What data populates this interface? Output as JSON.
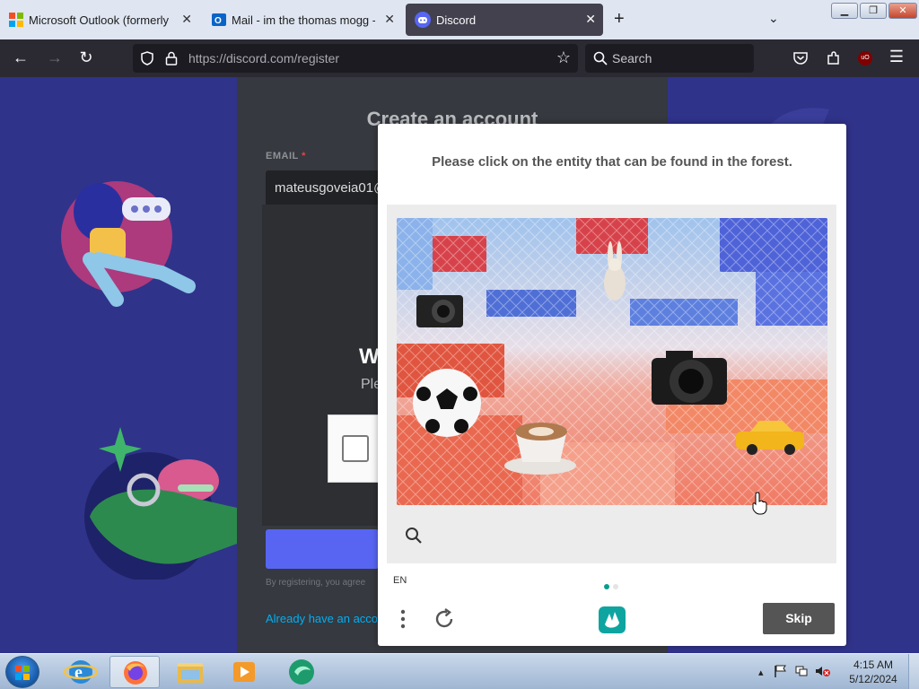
{
  "browser": {
    "tabs": [
      {
        "title": "Microsoft Outlook (formerly Ha",
        "icon": "microsoft-logo-icon",
        "active": false
      },
      {
        "title": "Mail - im the thomas mogg - O",
        "icon": "outlook-icon",
        "active": false
      },
      {
        "title": "Discord",
        "icon": "discord-icon",
        "active": true
      }
    ],
    "url_host": "https://discord.com",
    "url_path": "/register",
    "search_placeholder": "Search"
  },
  "page": {
    "form_title": "Create an account",
    "email_label": "EMAIL",
    "email_required": "*",
    "email_value": "mateusgoveia01@",
    "welcome_partial": "W",
    "please_partial": "Ple",
    "terms_partial": "By registering, you agree",
    "already_partial": "Already have an acco"
  },
  "captcha": {
    "prompt": "Please click on the entity that can be found in the forest.",
    "language": "EN",
    "skip_label": "Skip",
    "objects": [
      "rabbit",
      "camera",
      "soccer-ball",
      "coffee-cup",
      "camera",
      "taxi"
    ]
  },
  "taskbar": {
    "time": "4:15 AM",
    "date": "5/12/2024"
  },
  "colors": {
    "discord_blurple": "#5865f2",
    "captcha_skip": "#555555",
    "hcaptcha_teal": "#0a9b8f"
  }
}
